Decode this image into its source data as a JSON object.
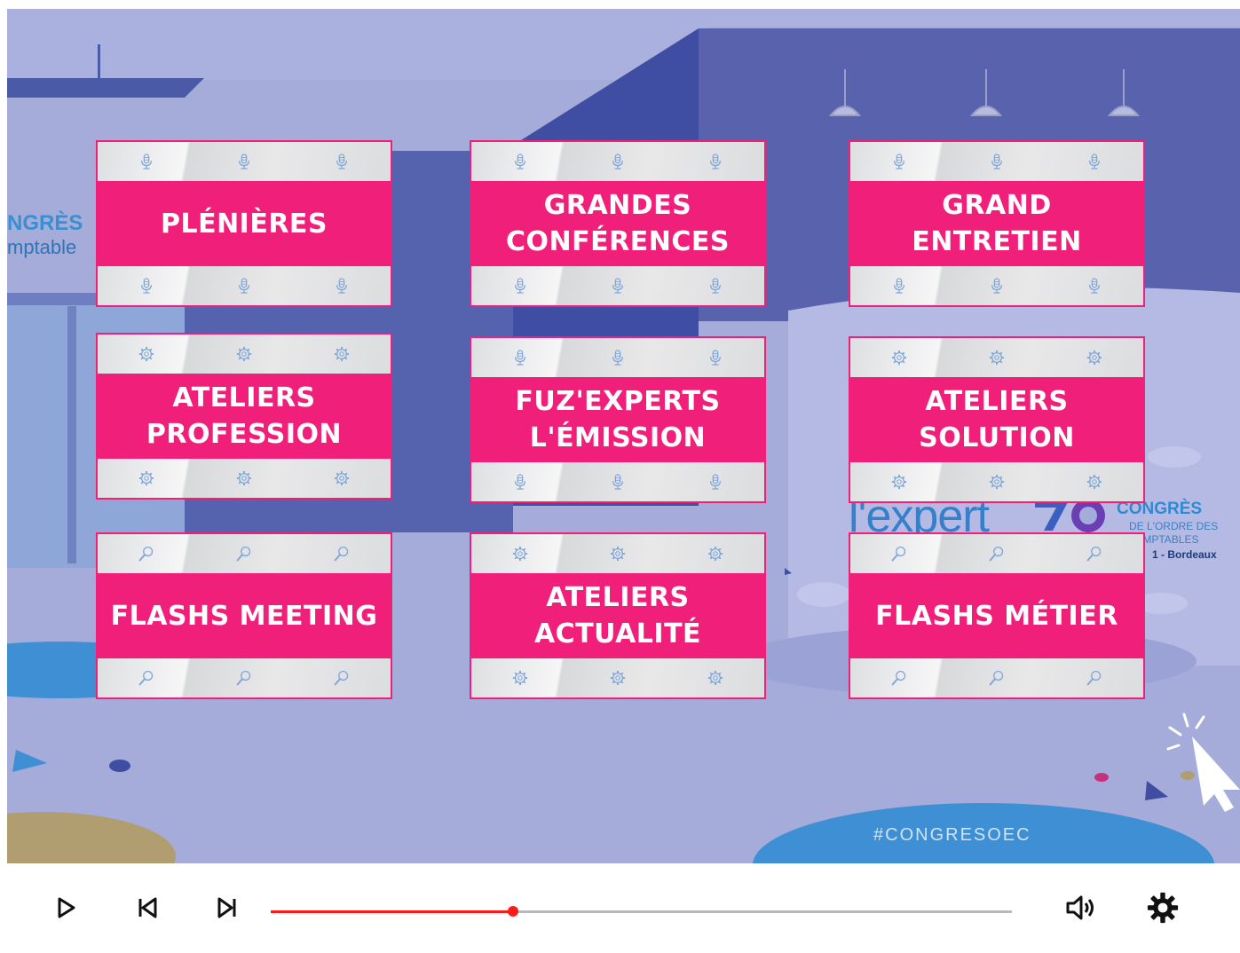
{
  "backdrop": {
    "banner_left_line1": "NGRÈS",
    "banner_left_line2": "mptable",
    "logo_word": "l'expert",
    "logo_congres": "CONGRÈS",
    "logo_sub1": "DE L'ORDRE DES",
    "logo_sub2": "OMPTABLES",
    "logo_sub3": "1 - Bordeaux",
    "hashtag": "#CONGRESOEC"
  },
  "menu": {
    "cards": [
      {
        "label": "PLÉNIÈRES",
        "icon": "microphone-icon"
      },
      {
        "label": "GRANDES\nCONFÉRENCES",
        "icon": "microphone-icon"
      },
      {
        "label": "GRAND\nENTRETIEN",
        "icon": "microphone-icon"
      },
      {
        "label": "ATELIERS\nPROFESSION",
        "icon": "gear-icon"
      },
      {
        "label": "FUZ'EXPERTS\nL'ÉMISSION",
        "icon": "microphone-icon"
      },
      {
        "label": "ATELIERS\nSOLUTION",
        "icon": "gear-icon"
      },
      {
        "label": "FLASHS MEETING",
        "icon": "magnifier-icon"
      },
      {
        "label": "ATELIERS\nACTUALITÉ",
        "icon": "gear-icon"
      },
      {
        "label": "FLASHS MÉTIER",
        "icon": "magnifier-icon"
      }
    ]
  },
  "player": {
    "progress": 0.327,
    "icons": [
      "play-icon",
      "skip-back-icon",
      "skip-forward-icon",
      "volume-icon",
      "settings-gear-icon"
    ]
  },
  "colors": {
    "accent_pink": "#f01f7a",
    "icon_blue": "#7ea6d9",
    "progress_red": "#ff1a1a",
    "backdrop": "#a7aedb"
  }
}
